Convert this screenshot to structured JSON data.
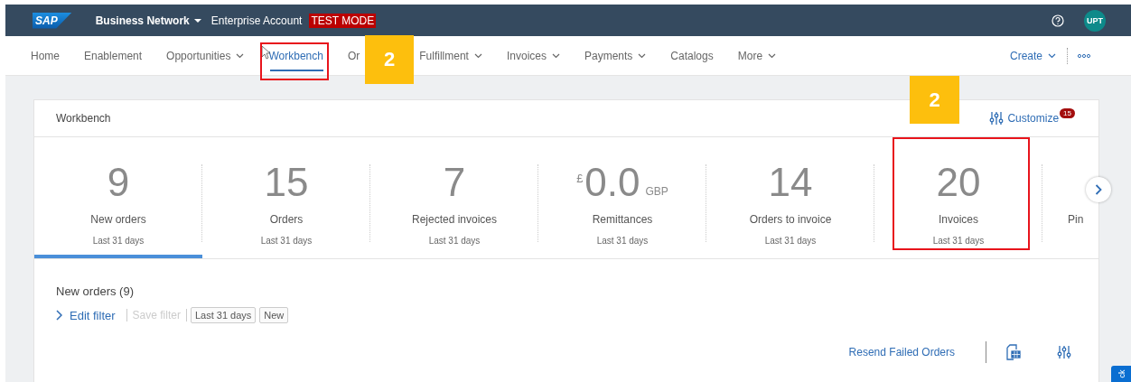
{
  "header": {
    "logo": "SAP",
    "product": "Business Network",
    "account": "Enterprise Account",
    "mode_badge": "TEST MODE",
    "avatar": "UPT"
  },
  "nav": {
    "items": [
      {
        "label": "Home",
        "dropdown": false,
        "selected": false
      },
      {
        "label": "Enablement",
        "dropdown": false,
        "selected": false
      },
      {
        "label": "Opportunities",
        "dropdown": true,
        "selected": false
      },
      {
        "label": "Workbench",
        "dropdown": false,
        "selected": true
      },
      {
        "label": "Or",
        "dropdown": false,
        "selected": false
      },
      {
        "label": "Fulfillment",
        "dropdown": true,
        "selected": false
      },
      {
        "label": "Invoices",
        "dropdown": true,
        "selected": false
      },
      {
        "label": "Payments",
        "dropdown": true,
        "selected": false
      },
      {
        "label": "Catalogs",
        "dropdown": false,
        "selected": false
      },
      {
        "label": "More",
        "dropdown": true,
        "selected": false
      }
    ],
    "create": "Create"
  },
  "workbench": {
    "title": "Workbench",
    "customize": {
      "label": "Customize",
      "count": "15"
    },
    "tiles": [
      {
        "kind": "count",
        "value": "9",
        "label": "New orders",
        "period": "Last 31 days",
        "selected": true
      },
      {
        "kind": "count",
        "value": "15",
        "label": "Orders",
        "period": "Last 31 days",
        "selected": false
      },
      {
        "kind": "count",
        "value": "7",
        "label": "Rejected invoices",
        "period": "Last 31 days",
        "selected": false
      },
      {
        "kind": "currency",
        "prefix": "£",
        "value": "0.0",
        "suffix": "GBP",
        "label": "Remittances",
        "period": "Last 31 days",
        "selected": false
      },
      {
        "kind": "count",
        "value": "14",
        "label": "Orders to invoice",
        "period": "Last 31 days",
        "selected": false
      },
      {
        "kind": "count",
        "value": "20",
        "label": "Invoices",
        "period": "Last 31 days",
        "selected": false
      },
      {
        "kind": "partial",
        "label": "Pin",
        "selected": false
      }
    ]
  },
  "list": {
    "title": "New orders (9)",
    "edit_filter": "Edit filter",
    "save_filter": {
      "label": "Save filter",
      "disabled": true
    },
    "chips": [
      "Last 31 days",
      "New"
    ],
    "resend": "Resend Failed Orders"
  },
  "feedback": "ck",
  "annotations": [
    {
      "kind": "frame"
    },
    {
      "kind": "badge",
      "text": "2"
    },
    {
      "kind": "badge",
      "text": "2"
    },
    {
      "kind": "frame"
    }
  ]
}
